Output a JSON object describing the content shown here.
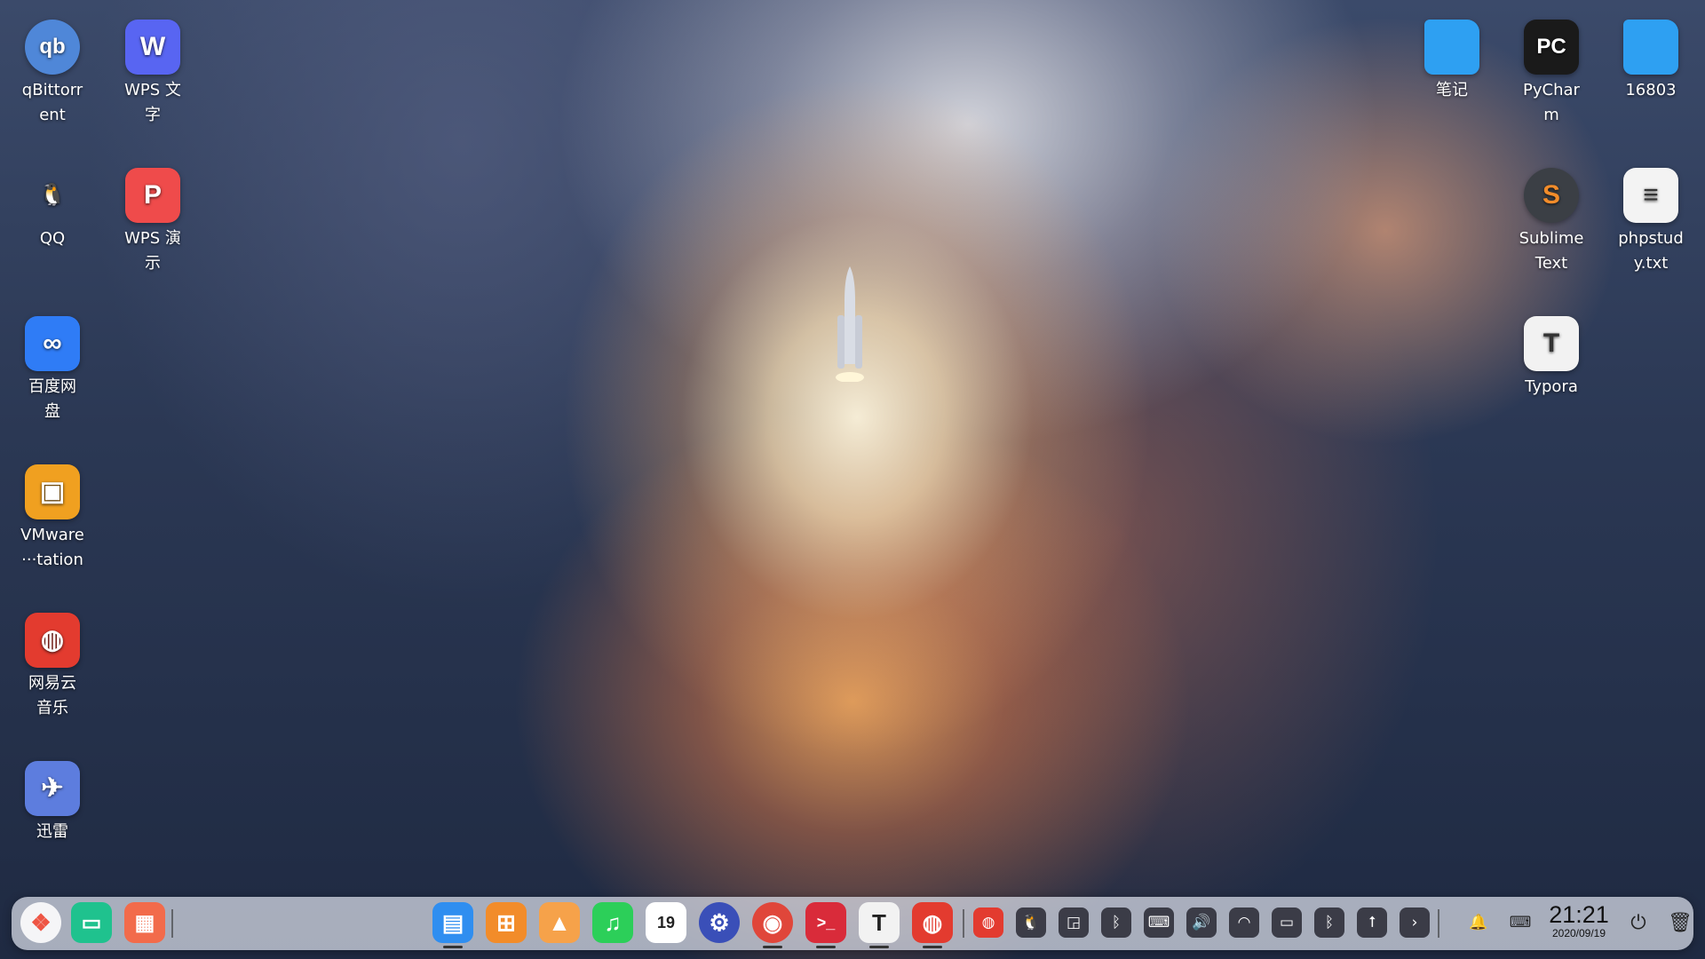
{
  "desktop": {
    "left_column_1": [
      {
        "name": "qBittorrent",
        "label": "qBittorr\nent",
        "icon": "qbittorrent-icon",
        "glyph": "qb",
        "color": "#4f87d8"
      },
      {
        "name": "QQ",
        "label": "QQ",
        "icon": "qq-penguin-icon",
        "glyph": "🐧",
        "color": "#111111"
      },
      {
        "name": "Baidu Netdisk",
        "label": "百度网\n盘",
        "icon": "baidu-netdisk-icon",
        "glyph": "∞",
        "color": "#2f7cf6"
      },
      {
        "name": "VMware Workstation",
        "label": "VMware\n···tation",
        "icon": "vmware-icon",
        "glyph": "▣",
        "color": "#f0a020"
      },
      {
        "name": "NetEase Cloud Music",
        "label": "网易云\n音乐",
        "icon": "netease-music-icon",
        "glyph": "◍",
        "color": "#e33b2f"
      },
      {
        "name": "Xunlei",
        "label": "迅雷",
        "icon": "xunlei-bird-icon",
        "glyph": "✈",
        "color": "#5d7dde"
      }
    ],
    "left_column_2": [
      {
        "name": "WPS Writer",
        "label": "WPS 文\n字",
        "icon": "wps-writer-icon",
        "glyph": "W",
        "color": "#5865f2"
      },
      {
        "name": "WPS Presentation",
        "label": "WPS 演\n示",
        "icon": "wps-presentation-icon",
        "glyph": "P",
        "color": "#ef4b4b"
      }
    ],
    "right_icons": [
      {
        "name": "笔记",
        "label": "笔记",
        "icon": "folder-icon",
        "glyph": "",
        "color": "#2ea0f2"
      },
      {
        "name": "PyCharm",
        "label": "PyChar\nm",
        "icon": "pycharm-icon",
        "glyph": "PC",
        "color": "#1a1a1a"
      },
      {
        "name": "16803",
        "label": "16803",
        "icon": "folder-icon",
        "glyph": "",
        "color": "#2ea0f2"
      },
      {
        "name": "Sublime Text",
        "label": "Sublime\nText",
        "icon": "sublime-text-icon",
        "glyph": "S",
        "color": "#3b3f45"
      },
      {
        "name": "phpstudy.txt",
        "label": "phpstud\ny.txt",
        "icon": "text-file-icon",
        "glyph": "≡",
        "color": "#f3f3f3"
      },
      {
        "name": "Typora",
        "label": "Typora",
        "icon": "typora-icon",
        "glyph": "T",
        "color": "#f2f2f2"
      }
    ]
  },
  "dock": {
    "launcher": {
      "icon": "launcher-icon",
      "glyph": "❖"
    },
    "left_apps": [
      {
        "name": "multitask-view",
        "icon": "multitask-view-icon",
        "glyph": "▭",
        "color": "#1fc28e"
      },
      {
        "name": "workspace",
        "icon": "workspace-grid-icon",
        "glyph": "▦",
        "color": "#f26b4b"
      }
    ],
    "apps": [
      {
        "name": "file-manager",
        "icon": "file-manager-icon",
        "glyph": "▤",
        "color": "#2f8ef0",
        "running": true
      },
      {
        "name": "app-store",
        "icon": "app-store-icon",
        "glyph": "⊞",
        "color": "#f28c2a",
        "running": false
      },
      {
        "name": "image-viewer",
        "icon": "image-viewer-icon",
        "glyph": "▲",
        "color": "#f6a24a",
        "running": false
      },
      {
        "name": "music",
        "icon": "music-icon",
        "glyph": "♫",
        "color": "#2ccf59",
        "running": false
      },
      {
        "name": "calendar",
        "icon": "calendar-icon",
        "glyph": "19",
        "color": "#ffffff",
        "running": false
      },
      {
        "name": "system-settings",
        "icon": "settings-gear-icon",
        "glyph": "⚙",
        "color": "#3a4fb8",
        "running": false
      },
      {
        "name": "chrome",
        "icon": "chrome-icon",
        "glyph": "◉",
        "color": "#e0463a",
        "running": true
      },
      {
        "name": "terminal",
        "icon": "terminal-icon",
        "glyph": ">_",
        "color": "#d92b3a",
        "running": true
      },
      {
        "name": "typora",
        "icon": "typora-icon",
        "glyph": "T",
        "color": "#f2f2f2",
        "running": true
      },
      {
        "name": "netease-music",
        "icon": "netease-music-icon",
        "glyph": "◍",
        "color": "#e33b2f",
        "running": true
      }
    ],
    "tray": [
      {
        "name": "netease-tray",
        "icon": "netease-music-icon",
        "glyph": "◍"
      },
      {
        "name": "qq-tray",
        "icon": "qq-penguin-icon",
        "glyph": "🐧"
      },
      {
        "name": "screenshot-tray",
        "icon": "screenshot-icon",
        "glyph": "◲"
      },
      {
        "name": "bluetooth-manager",
        "icon": "bluetooth-icon",
        "glyph": "ᛒ"
      },
      {
        "name": "keyboard",
        "icon": "keyboard-icon",
        "glyph": "⌨"
      },
      {
        "name": "volume",
        "icon": "volume-icon",
        "glyph": "🔊"
      },
      {
        "name": "wifi",
        "icon": "wifi-icon",
        "glyph": "◠"
      },
      {
        "name": "display",
        "icon": "display-icon",
        "glyph": "▭"
      },
      {
        "name": "bluetooth",
        "icon": "bluetooth-icon",
        "glyph": "ᛒ"
      },
      {
        "name": "usb",
        "icon": "usb-icon",
        "glyph": "⭡"
      },
      {
        "name": "expand-tray",
        "icon": "chevron-right-icon",
        "glyph": "›"
      },
      {
        "name": "notifications",
        "icon": "bell-icon",
        "glyph": "🔔"
      },
      {
        "name": "onscreen-keyboard",
        "icon": "keyboard-icon",
        "glyph": "⌨"
      }
    ],
    "clock": {
      "time": "21:21",
      "date": "2020/09/19"
    },
    "power": {
      "icon": "power-icon",
      "glyph": "⏻"
    },
    "trash": {
      "icon": "trash-icon",
      "glyph": "🗑"
    }
  }
}
